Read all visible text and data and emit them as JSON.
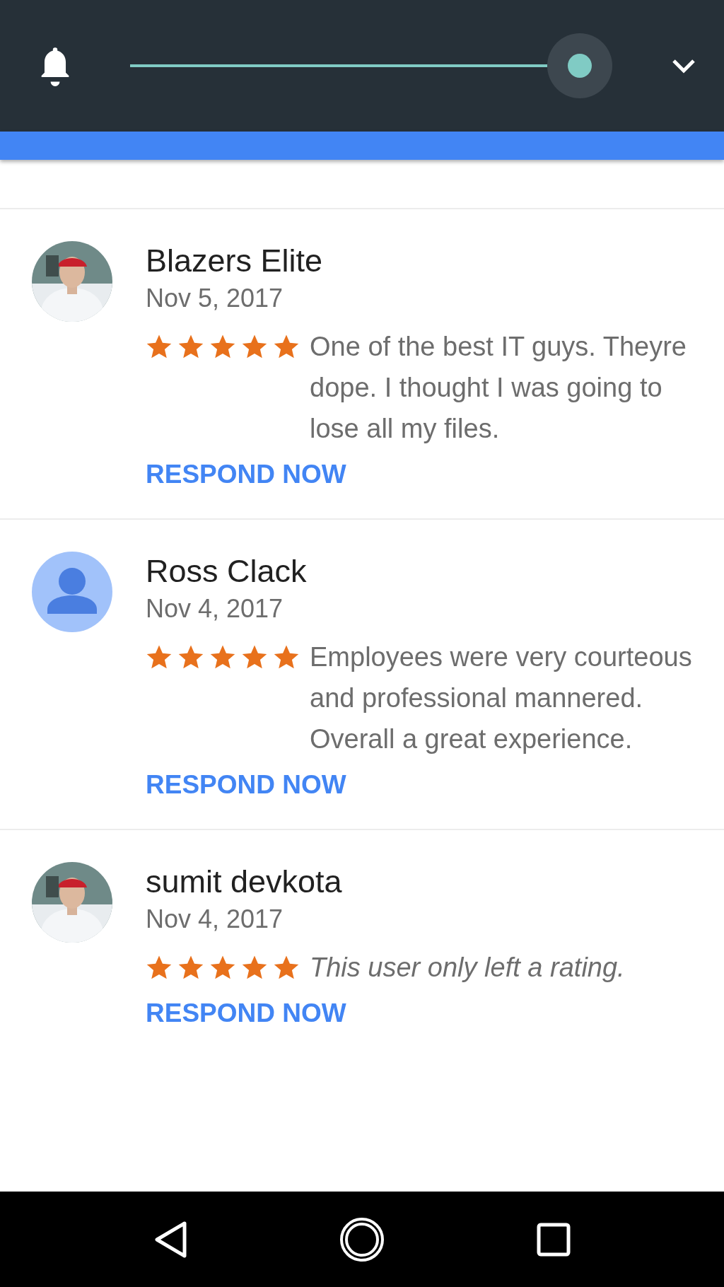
{
  "notification_shade": {
    "slider": {
      "level": 1
    }
  },
  "reviews": [
    {
      "name": "Blazers Elite",
      "date": "Nov 5, 2017",
      "stars": 5,
      "kind": "text",
      "text": "One of the best IT guys. Theyre dope. I thought I was going to lose all my files.",
      "respond_label": "RESPOND NOW"
    },
    {
      "name": "Ross Clack",
      "date": "Nov 4, 2017",
      "avatar": {
        "kind": "default"
      },
      "stars": 5,
      "kind": "text",
      "text": "Employees were very courteous and professional mannered. Overall a great experience.",
      "respond_label": "RESPOND NOW"
    },
    {
      "name": "sumit devkota",
      "date": "Nov 4, 2017",
      "stars": 5,
      "kind": "rating_only",
      "text": "This user only left a rating.",
      "respond_label": "RESPOND NOW"
    }
  ]
}
